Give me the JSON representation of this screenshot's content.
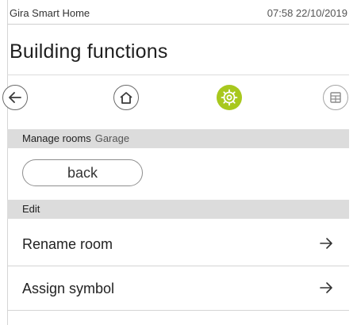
{
  "status_bar": {
    "app_name": "Gira Smart Home",
    "clock": "07:58 22/10/2019"
  },
  "page_title": "Building functions",
  "nav": {
    "back_icon": "arrow-left-icon",
    "home_icon": "home-icon",
    "settings_icon": "gear-icon",
    "grid_icon": "grid-icon",
    "settings_active_color": "#a8c81e"
  },
  "manage_rooms": {
    "title": "Manage rooms",
    "room": "Garage"
  },
  "back_button": {
    "label": "back"
  },
  "edit_section": {
    "title": "Edit",
    "items": [
      {
        "label": "Rename room",
        "icon": "arrow-right-icon"
      },
      {
        "label": "Assign symbol",
        "icon": "arrow-right-icon"
      }
    ]
  }
}
